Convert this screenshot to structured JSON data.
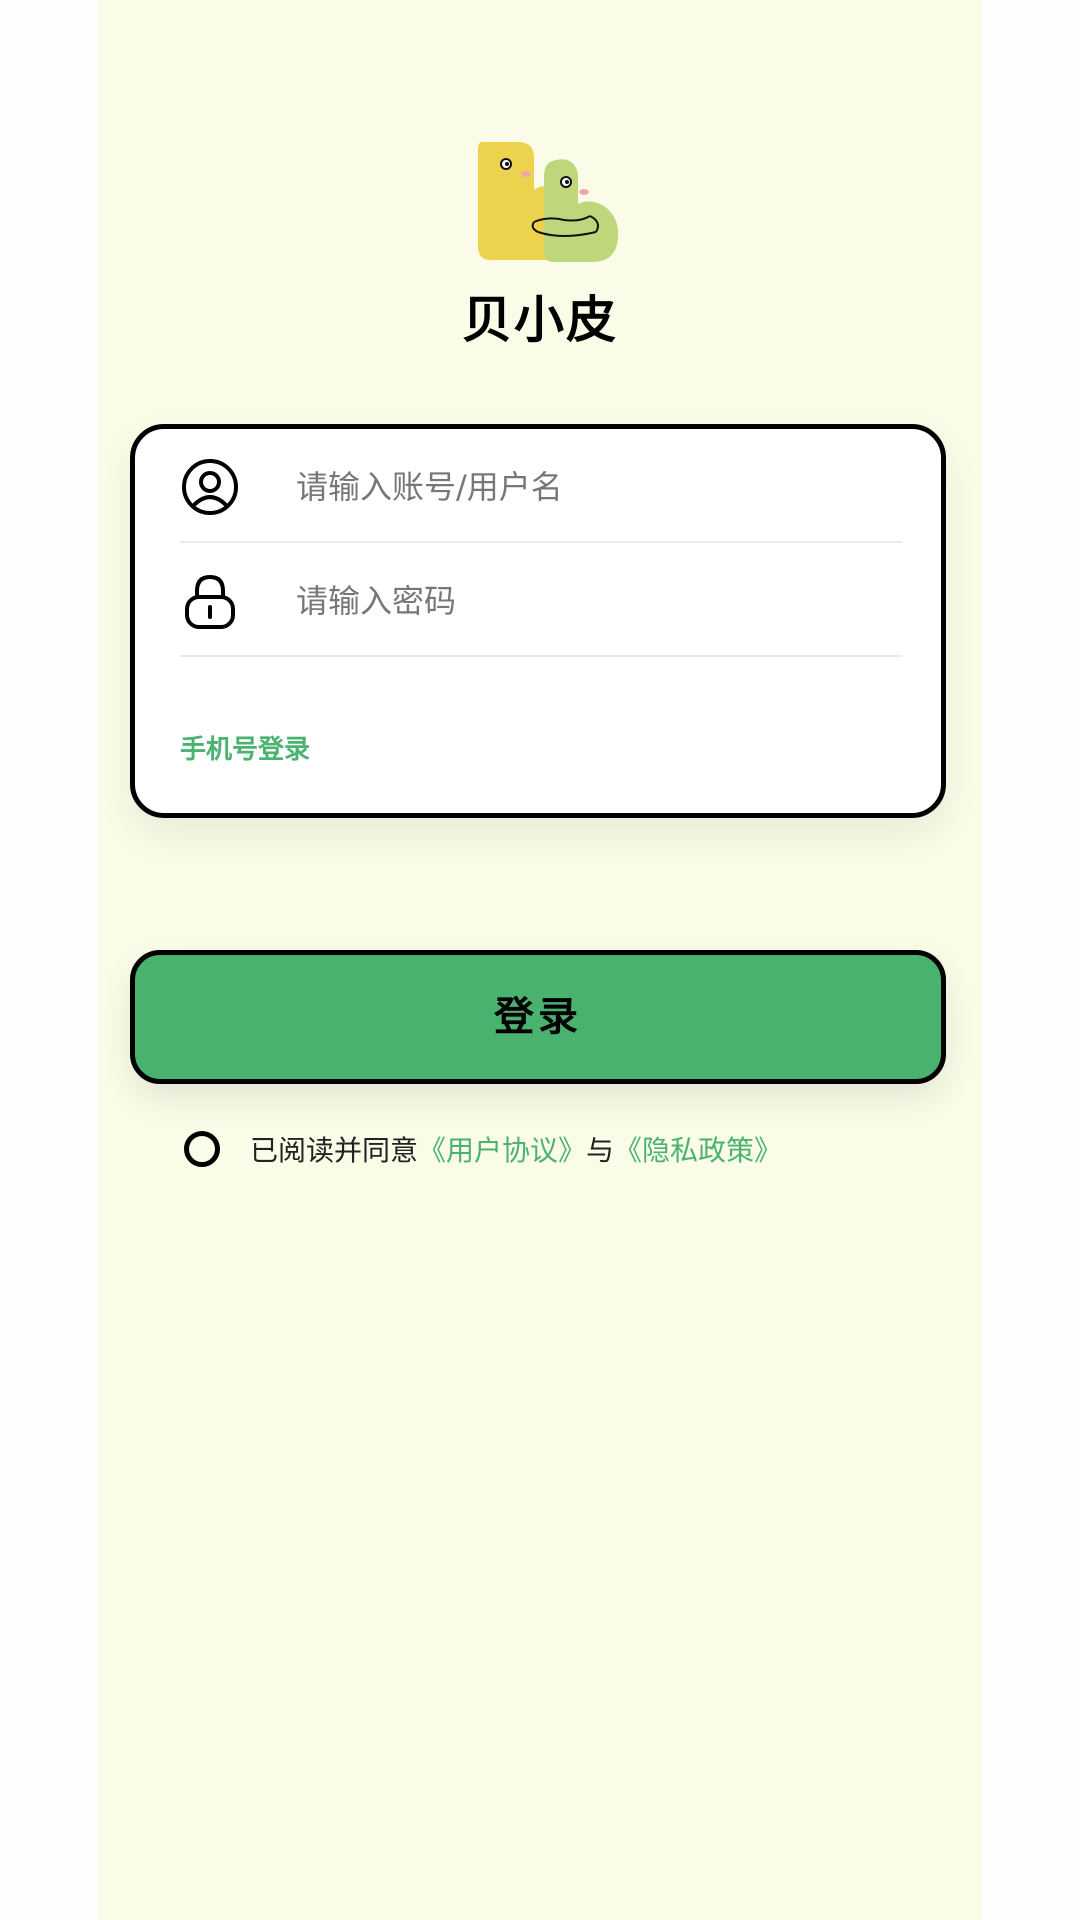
{
  "app": {
    "name": "贝小皮",
    "logo_icon": "bb-mascot-logo"
  },
  "login_form": {
    "account": {
      "icon": "user-circle-icon",
      "placeholder": "请输入账号/用户名",
      "value": ""
    },
    "password": {
      "icon": "lock-icon",
      "placeholder": "请输入密码",
      "value": ""
    },
    "phone_login_label": "手机号登录"
  },
  "login_button": {
    "label": "登录"
  },
  "agreement": {
    "checked": false,
    "prefix": "已阅读并同意",
    "user_agreement": "《用户协议》",
    "conjunction": "与",
    "privacy_policy": "《隐私政策》"
  },
  "colors": {
    "page_background": "#fafce8",
    "accent_green": "#49b26f",
    "link_green": "#4bb270",
    "border": "#000000",
    "logo_yellow": "#ecd24d",
    "logo_green": "#bed77a"
  }
}
